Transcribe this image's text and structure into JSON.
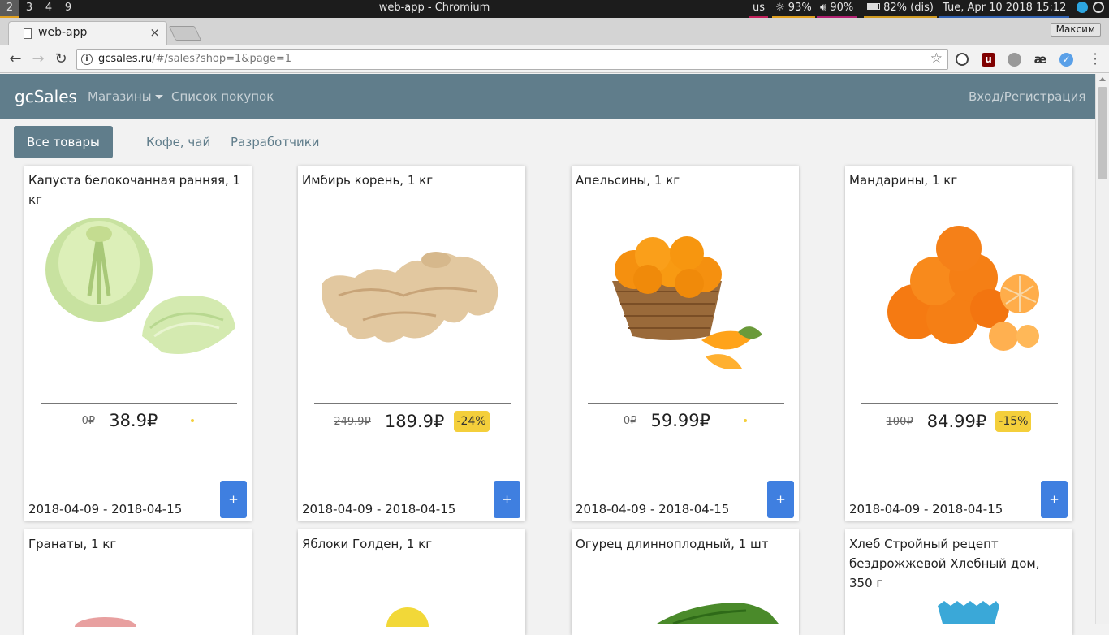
{
  "os_bar": {
    "workspaces": [
      "2",
      "3",
      "4",
      "9"
    ],
    "window_title": "web-app - Chromium",
    "keyboard_layout": "us",
    "brightness": "93%",
    "volume": "90%",
    "battery": "82% (dis)",
    "datetime": "Tue, Apr 10 2018 15:12"
  },
  "browser": {
    "tab_title": "web-app",
    "tab_close": "×",
    "profile_name": "Максим",
    "url_host": "gcsales.ru",
    "url_path": "/#/sales?shop=1&page=1"
  },
  "app": {
    "brand": "gcSales",
    "nav": {
      "shops": "Магазины",
      "shopping_list": "Список покупок",
      "login": "Вход/Регистрация"
    },
    "categories": {
      "all": "Все товары",
      "coffee_tea": "Кофе, чай",
      "developers": "Разработчики"
    },
    "add_label": "+",
    "products": [
      {
        "title": "Капуста белокочанная ранняя, 1 кг",
        "old_price": "0₽",
        "price": "38.9₽",
        "discount": "",
        "dates": "2018-04-09 - 2018-04-15",
        "image": "cabbage"
      },
      {
        "title": "Имбирь корень, 1 кг",
        "old_price": "249.9₽",
        "price": "189.9₽",
        "discount": "-24%",
        "dates": "2018-04-09 - 2018-04-15",
        "image": "ginger"
      },
      {
        "title": "Апельсины, 1 кг",
        "old_price": "0₽",
        "price": "59.99₽",
        "discount": "",
        "dates": "2018-04-09 - 2018-04-15",
        "image": "oranges"
      },
      {
        "title": "Мандарины, 1 кг",
        "old_price": "100₽",
        "price": "84.99₽",
        "discount": "-15%",
        "dates": "2018-04-09 - 2018-04-15",
        "image": "tangerines"
      },
      {
        "title": "Гранаты, 1 кг",
        "image": "pomegranate"
      },
      {
        "title": "Яблоки Голден, 1 кг",
        "image": "apple"
      },
      {
        "title": "Огурец длинноплодный, 1 шт",
        "image": "cucumber"
      },
      {
        "title": "Хлеб Стройный рецепт бездрожжевой Хлебный дом, 350 г",
        "image": "bread"
      }
    ]
  },
  "colors": {
    "navbar": "#607d8b",
    "add_button": "#3f7fe0",
    "discount_badge": "#f4cf3b"
  }
}
